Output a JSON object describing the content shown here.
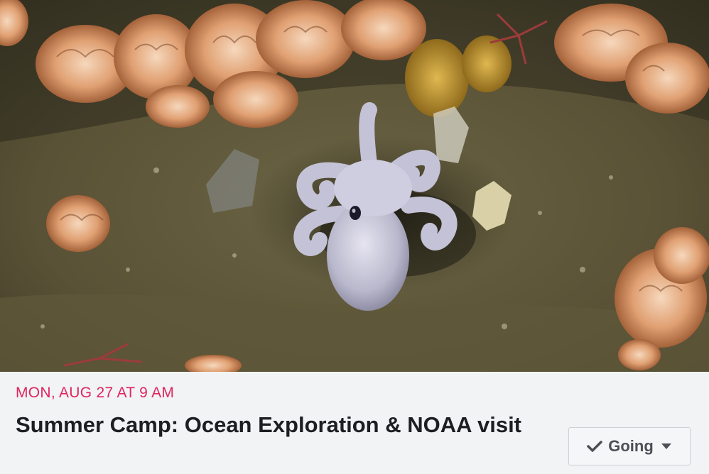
{
  "event": {
    "cover_image": "octopus-seafloor-photo",
    "date": "MON, AUG 27 AT 9 AM",
    "title": "Summer Camp: Ocean Exploration & NOAA visit",
    "rsvp_label": "Going"
  },
  "icons": {
    "rsvp_check": "check-icon",
    "rsvp_dropdown": "caret-down-icon"
  },
  "colors": {
    "date_text": "#e0245e",
    "title_text": "#1c1e21",
    "button_text": "#4b4f56",
    "background": "#f2f3f5"
  }
}
